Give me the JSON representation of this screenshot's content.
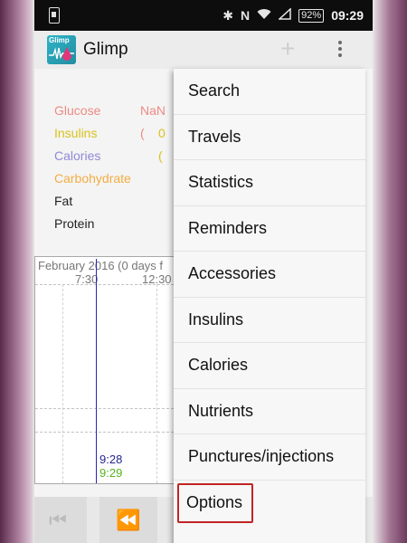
{
  "status_bar": {
    "battery": "92%",
    "time": "09:29",
    "icons": [
      "sim-icon",
      "bluetooth-icon",
      "nfc-icon",
      "wifi-icon",
      "signal-icon",
      "battery-icon"
    ]
  },
  "app_bar": {
    "logo_text": "Glimp",
    "title": "Glimp",
    "add_icon": "plus-icon",
    "overflow_icon": "more-vert-icon"
  },
  "nutrients": [
    {
      "label": "Glucose",
      "value": "NaN (",
      "color": "#ee8a84"
    },
    {
      "label": "Insulins",
      "value": "0 (",
      "color": "#d9c21a"
    },
    {
      "label": "Calories",
      "value": "",
      "color": "#8f88d8"
    },
    {
      "label": "Carbohydrate",
      "value": "",
      "color": "#f3ac43"
    },
    {
      "label": "Fat",
      "value": "",
      "color": "#222222"
    },
    {
      "label": "Protein",
      "value": "",
      "color": "#222222"
    }
  ],
  "chart": {
    "title": "February 2016 (0 days f",
    "times": [
      "7:30",
      "12:30"
    ],
    "time_a": "9:28",
    "time_b": "9:29",
    "line_color": "#2828b6",
    "time_b_color": "#56b41c"
  },
  "bottom_bar": {
    "buttons": [
      {
        "icon": "skip-previous-icon",
        "glyph": "⏮"
      },
      {
        "icon": "rewind-icon",
        "glyph": "⏪"
      }
    ]
  },
  "menu": {
    "items": [
      "Search",
      "Travels",
      "Statistics",
      "Reminders",
      "Accessories",
      "Insulins",
      "Calories",
      "Nutrients",
      "Punctures/injections",
      "Options"
    ],
    "highlight_color": "#c02525"
  }
}
